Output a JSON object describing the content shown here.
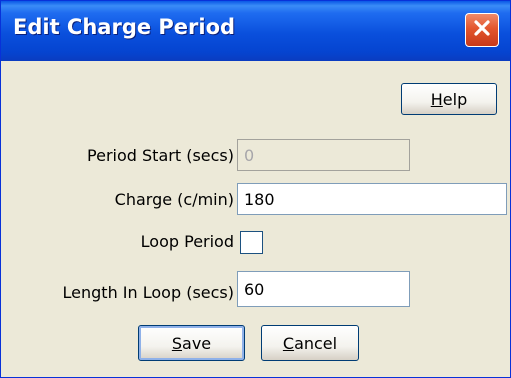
{
  "window": {
    "title": "Edit Charge Period",
    "close_icon": "close-x-icon"
  },
  "buttons": {
    "help": {
      "mnemonic": "H",
      "rest": "elp"
    },
    "save": {
      "mnemonic": "S",
      "rest": "ave"
    },
    "cancel": {
      "mnemonic": "C",
      "rest": "ancel"
    }
  },
  "form": {
    "period_start": {
      "label": "Period Start (secs)",
      "value": "0",
      "enabled": false
    },
    "charge": {
      "label": "Charge (c/min)",
      "value": "180"
    },
    "loop_period": {
      "label": "Loop Period",
      "checked": false
    },
    "length_in_loop": {
      "label": "Length In Loop (secs)",
      "value": "60"
    }
  },
  "colors": {
    "titlebar": "#0a4fdc",
    "close_button": "#e3562d",
    "dialog_background": "#ece9d8"
  }
}
